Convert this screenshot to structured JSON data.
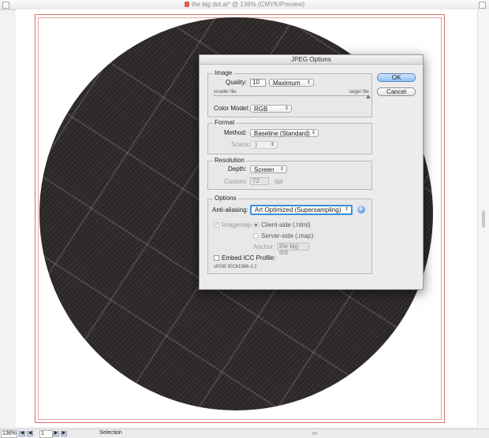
{
  "window": {
    "title": "the big dot.ai* @ 136% (CMYK/Preview)"
  },
  "colors": {
    "artboard_border": "#d9706a",
    "dot_fill": "#2b2626",
    "focus_ring": "#3a8de0",
    "default_button": "#8ec2f4"
  },
  "dialog": {
    "title": "JPEG Options",
    "ok_label": "OK",
    "cancel_label": "Cancel",
    "image": {
      "legend": "Image",
      "quality_label": "Quality:",
      "quality_value": "10",
      "quality_preset": "Maximum",
      "small_label": "smaller file",
      "large_label": "larger file",
      "quality_fraction": 1.0,
      "color_model_label": "Color Model:",
      "color_model_value": "RGB"
    },
    "format": {
      "legend": "Format",
      "method_label": "Method:",
      "method_value": "Baseline (Standard)",
      "scans_label": "Scans:",
      "scans_value": "3"
    },
    "resolution": {
      "legend": "Resolution",
      "depth_label": "Depth:",
      "depth_value": "Screen",
      "custom_label": "Custom:",
      "custom_value": "72",
      "custom_unit": "dpi"
    },
    "options": {
      "legend": "Options",
      "antialias_label": "Anti-aliasing:",
      "antialias_value": "Art Optimized (Supersampling)",
      "imagemap_label": "Imagemap",
      "client_side_label": "Client-side (.html)",
      "server_side_label": "Server-side (.map)",
      "anchor_label": "Anchor:",
      "anchor_value": "the big dot",
      "embed_icc_label": "Embed ICC Profile:",
      "profile_name": "sRGB IEC61966-2.1"
    }
  },
  "status": {
    "zoom": "136%",
    "page": "1",
    "mode": "Selection"
  },
  "icons": {
    "check": "✓",
    "arrows": "⇕",
    "info": "i",
    "first": "◀",
    "last": "▶"
  }
}
